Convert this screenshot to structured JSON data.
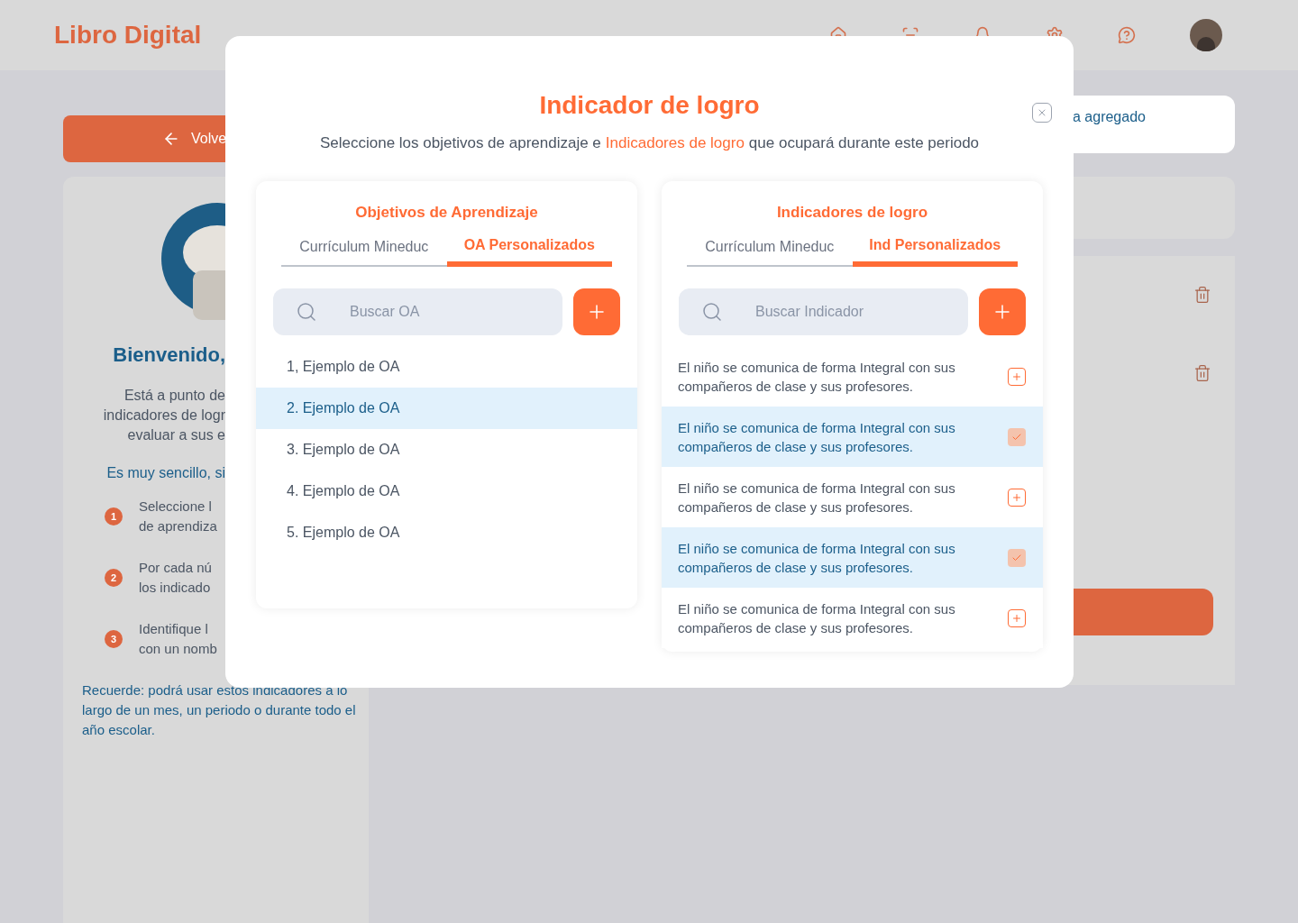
{
  "header": {
    "logo": "Libro Digital",
    "nav_icons": [
      {
        "kind": "home"
      },
      {
        "kind": "scan"
      },
      {
        "kind": "bell"
      },
      {
        "kind": "settings"
      },
      {
        "kind": "help"
      }
    ]
  },
  "back_button": {
    "label": "Volve"
  },
  "welcome": {
    "title": "Bienvenido,",
    "intro_lines": [
      "Está a punto de",
      "indicadores de logr",
      "evaluar a sus e"
    ],
    "hint": "Es muy sencillo, si",
    "steps": [
      {
        "number": "1",
        "lines": [
          "Seleccione l",
          "de aprendiza"
        ]
      },
      {
        "number": "2",
        "lines": [
          "Por cada nú",
          "los indicado"
        ]
      },
      {
        "number": "3",
        "lines": [
          "Identifique l",
          "con un nomb"
        ]
      }
    ],
    "reminder": "Recuerde: podrá usar estos indicadores a lo largo de un mes, un periodo o durante todo el año escolar."
  },
  "banner": {
    "text": "a agregado"
  },
  "modal": {
    "title": "Indicador de logro",
    "subtitle": {
      "before": "Seleccione los objetivos de aprendizaje e",
      "highlight": "Indicadores de logro",
      "after": "que ocupará durante este periodo"
    },
    "panels": [
      {
        "title": "Objetivos de Aprendizaje",
        "tabs": [
          {
            "label": "Currículum Mineduc",
            "selected": false
          },
          {
            "label": "OA Personalizados",
            "selected": true
          }
        ],
        "search_placeholder": "Buscar OA",
        "kind": "objectives",
        "items": [
          {
            "text": "1, Ejemplo de OA",
            "selected": false
          },
          {
            "text": "2. Ejemplo de OA",
            "selected": true
          },
          {
            "text": "3. Ejemplo de OA",
            "selected": false
          },
          {
            "text": "4. Ejemplo de OA",
            "selected": false
          },
          {
            "text": "5. Ejemplo de OA",
            "selected": false
          }
        ]
      },
      {
        "title": "Indicadores de logro",
        "tabs": [
          {
            "label": "Currículum Mineduc",
            "selected": false
          },
          {
            "label": "Ind Personalizados",
            "selected": true
          }
        ],
        "search_placeholder": "Buscar Indicador",
        "kind": "indicators",
        "items": [
          {
            "text": "El niño se comunica de forma Integral con sus compañeros de clase y sus profesores.",
            "selected": false
          },
          {
            "text": "El niño se comunica de forma Integral con sus compañeros de clase y sus profesores.",
            "selected": true
          },
          {
            "text": "El niño se comunica de forma Integral con sus compañeros de clase y sus profesores.",
            "selected": false
          },
          {
            "text": "El niño se comunica de forma Integral con sus compañeros de clase y sus profesores.",
            "selected": true
          },
          {
            "text": "El niño se comunica de forma Integral con sus compañeros de clase y sus profesores.",
            "selected": false
          }
        ]
      }
    ]
  }
}
